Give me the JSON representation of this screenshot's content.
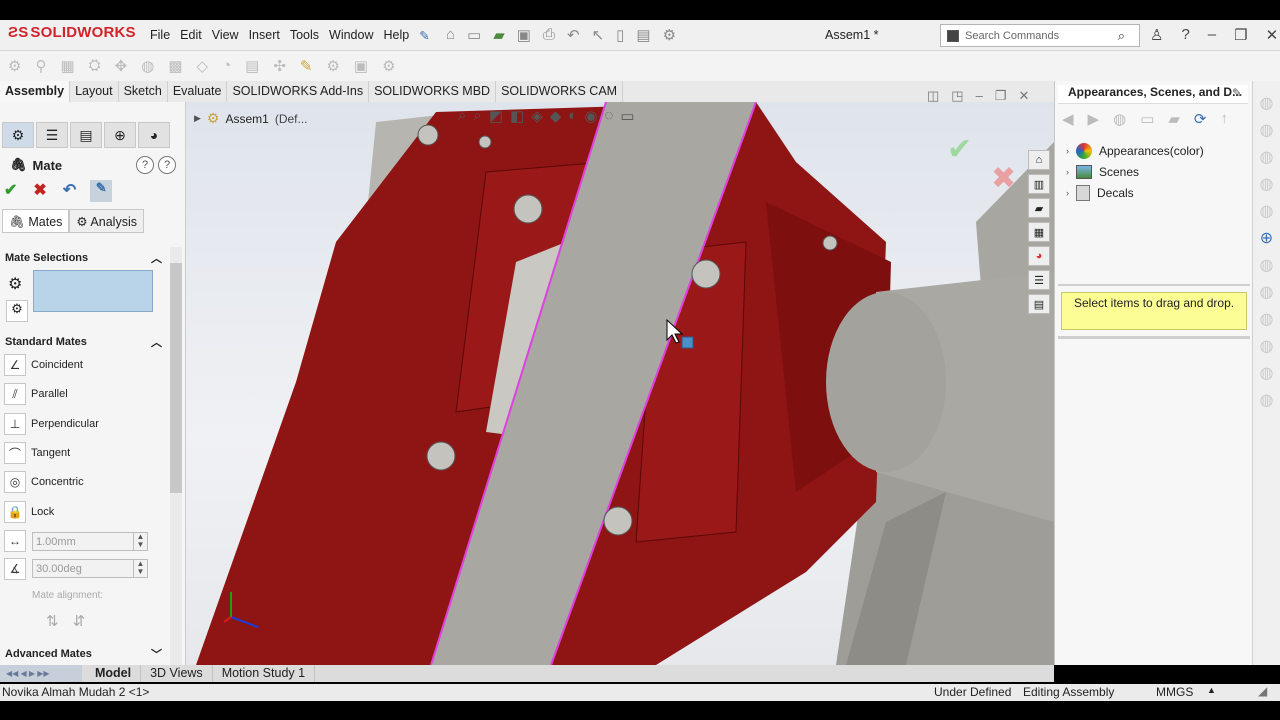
{
  "app": {
    "logo": "SOLIDWORKS",
    "document_title": "Assem1 *",
    "menu": [
      "File",
      "Edit",
      "View",
      "Insert",
      "Tools",
      "Window",
      "Help"
    ],
    "search_placeholder": "Search Commands"
  },
  "command_tabs": [
    "Assembly",
    "Layout",
    "Sketch",
    "Evaluate",
    "SOLIDWORKS Add-Ins",
    "SOLIDWORKS MBD",
    "SOLIDWORKS CAM"
  ],
  "property_manager": {
    "title": "Mate",
    "subtabs": [
      "Mates",
      "Analysis"
    ],
    "sections": {
      "mate_selections": "Mate Selections",
      "standard_mates": "Standard Mates",
      "advanced_mates": "Advanced Mates"
    },
    "standard_mates": [
      "Coincident",
      "Parallel",
      "Perpendicular",
      "Tangent",
      "Concentric",
      "Lock"
    ],
    "distance_value": "1.00mm",
    "angle_value": "30.00deg",
    "mate_alignment_label": "Mate alignment:"
  },
  "feature_tree": {
    "root_label": "Assem1",
    "root_config": "(Def..."
  },
  "task_pane": {
    "title": "Appearances, Scenes, and D...",
    "items": [
      "Appearances(color)",
      "Scenes",
      "Decals"
    ],
    "hint": "Select items to drag and drop."
  },
  "bottom_tabs": [
    "Model",
    "3D Views",
    "Motion Study 1"
  ],
  "status": {
    "left": "Novika Almah Mudah 2 <1>",
    "state": "Under Defined",
    "mode": "Editing Assembly",
    "units": "MMGS"
  },
  "colors": {
    "accent_red": "#d2232a",
    "part_red": "#8f1414",
    "highlight_magenta": "#e040e0",
    "gray_part": "#a8a7a2",
    "selection_blue": "#b9d3e8",
    "tooltip_yellow": "#fdfd96"
  }
}
